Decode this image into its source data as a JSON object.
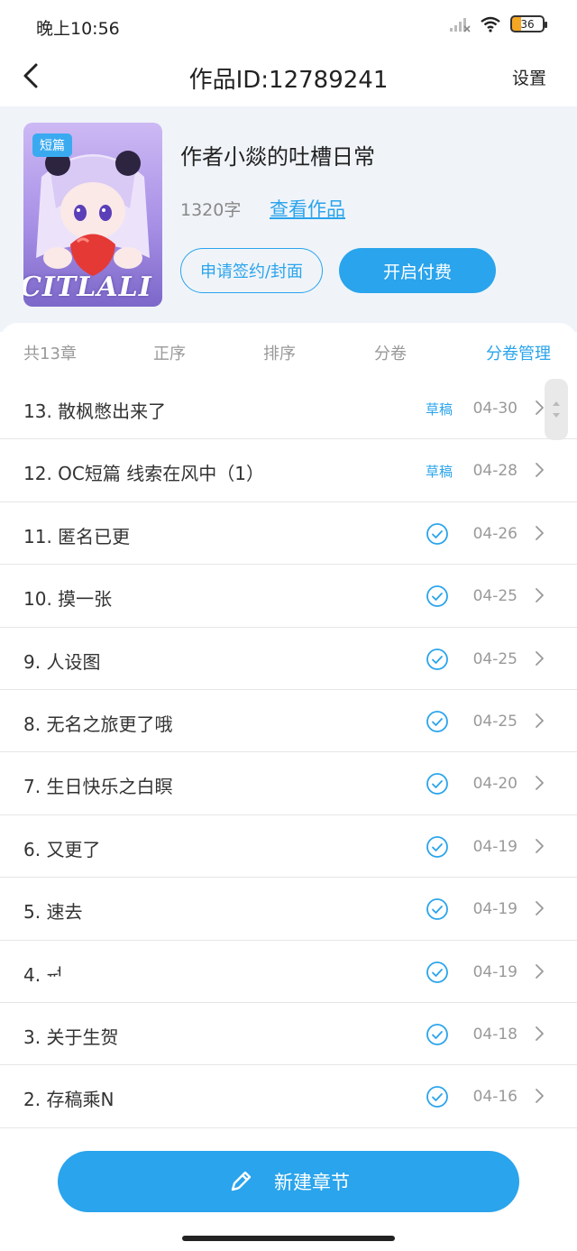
{
  "status_bar": {
    "time": "晚上10:56",
    "battery": "36"
  },
  "nav": {
    "title": "作品ID:12789241",
    "settings_label": "设置"
  },
  "work": {
    "cover_tag": "短篇",
    "cover_text": "CITLALI",
    "title": "作者小燚的吐槽日常",
    "word_count": "1320字",
    "view_label": "查看作品",
    "sign_label": "申请签约/封面",
    "pay_label": "开启付费"
  },
  "filters": {
    "total": "共13章",
    "order": "正序",
    "sort": "排序",
    "volume": "分卷",
    "volume_manage": "分卷管理"
  },
  "chapters": [
    {
      "title": "13. 散枫憋出来了",
      "status": "草稿",
      "date": "04-30"
    },
    {
      "title": "12. OC短篇 线索在风中（1）",
      "status": "草稿",
      "date": "04-28"
    },
    {
      "title": "11. 匿名已更",
      "status": "published",
      "date": "04-26"
    },
    {
      "title": "10. 摸一张",
      "status": "published",
      "date": "04-25"
    },
    {
      "title": "9. 人设图",
      "status": "published",
      "date": "04-25"
    },
    {
      "title": "8. 无名之旅更了哦",
      "status": "published",
      "date": "04-25"
    },
    {
      "title": "7. 生日快乐之白瞑",
      "status": "published",
      "date": "04-20"
    },
    {
      "title": "6. 又更了",
      "status": "published",
      "date": "04-19"
    },
    {
      "title": "5. 速去",
      "status": "published",
      "date": "04-19"
    },
    {
      "title": "4. ᆏ",
      "status": "published",
      "date": "04-19"
    },
    {
      "title": "3. 关于生贺",
      "status": "published",
      "date": "04-18"
    },
    {
      "title": "2. 存稿乘N",
      "status": "published",
      "date": "04-16"
    }
  ],
  "bottom": {
    "new_chapter_label": "新建章节"
  },
  "colors": {
    "accent": "#2aa4ec",
    "header_bg": "#f0f4f9"
  }
}
